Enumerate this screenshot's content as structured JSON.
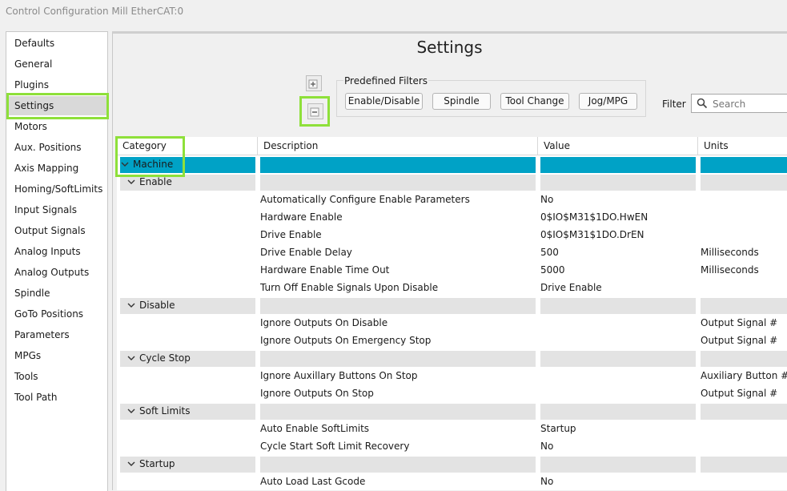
{
  "window": {
    "title": "Control Configuration Mill EtherCAT:0"
  },
  "sidebar": {
    "items": [
      {
        "label": "Defaults"
      },
      {
        "label": "General"
      },
      {
        "label": "Plugins"
      },
      {
        "label": "Settings",
        "selected": true
      },
      {
        "label": "Motors"
      },
      {
        "label": "Aux. Positions"
      },
      {
        "label": "Axis Mapping"
      },
      {
        "label": "Homing/SoftLimits"
      },
      {
        "label": "Input Signals"
      },
      {
        "label": "Output Signals"
      },
      {
        "label": "Analog Inputs"
      },
      {
        "label": "Analog Outputs"
      },
      {
        "label": "Spindle"
      },
      {
        "label": "GoTo Positions"
      },
      {
        "label": "Parameters"
      },
      {
        "label": "MPGs"
      },
      {
        "label": "Tools"
      },
      {
        "label": "Tool Path"
      }
    ]
  },
  "main": {
    "title": "Settings",
    "expand_icon": "expand-all-icon",
    "collapse_icon": "collapse-all-icon",
    "predefined_filters": {
      "legend": "Predefined Filters",
      "buttons": [
        "Enable/Disable",
        "Spindle",
        "Tool Change",
        "Jog/MPG"
      ]
    },
    "filter": {
      "label": "Filter",
      "placeholder": "Search",
      "value": ""
    }
  },
  "grid": {
    "columns": [
      "Category",
      "Description",
      "Value",
      "Units"
    ],
    "rows": [
      {
        "kind": "group",
        "level": 0,
        "category": "Machine",
        "selected": true
      },
      {
        "kind": "group",
        "level": 1,
        "category": "Enable"
      },
      {
        "kind": "item",
        "description": "Automatically Configure Enable Parameters",
        "value": "No",
        "units": ""
      },
      {
        "kind": "item",
        "description": "Hardware Enable",
        "value": "0$IO$M31$1DO.HwEN",
        "units": ""
      },
      {
        "kind": "item",
        "description": "Drive Enable",
        "value": "0$IO$M31$1DO.DrEN",
        "units": ""
      },
      {
        "kind": "item",
        "description": "Drive Enable Delay",
        "value": "500",
        "units": "Milliseconds"
      },
      {
        "kind": "item",
        "description": "Hardware Enable Time Out",
        "value": "5000",
        "units": "Milliseconds"
      },
      {
        "kind": "item",
        "description": "Turn Off Enable Signals Upon Disable",
        "value": "Drive Enable",
        "units": ""
      },
      {
        "kind": "group",
        "level": 1,
        "category": "Disable"
      },
      {
        "kind": "item",
        "description": "Ignore Outputs On Disable",
        "value": "",
        "units": "Output Signal #"
      },
      {
        "kind": "item",
        "description": "Ignore Outputs On Emergency Stop",
        "value": "",
        "units": "Output Signal #"
      },
      {
        "kind": "group",
        "level": 1,
        "category": "Cycle Stop"
      },
      {
        "kind": "item",
        "description": "Ignore Auxillary Buttons On Stop",
        "value": "",
        "units": "Auxiliary Button #"
      },
      {
        "kind": "item",
        "description": "Ignore Outputs On Stop",
        "value": "",
        "units": "Output Signal #"
      },
      {
        "kind": "group",
        "level": 1,
        "category": "Soft Limits"
      },
      {
        "kind": "item",
        "description": "Auto Enable SoftLimits",
        "value": "Startup",
        "units": ""
      },
      {
        "kind": "item",
        "description": "Cycle Start Soft Limit Recovery",
        "value": "No",
        "units": ""
      },
      {
        "kind": "group",
        "level": 1,
        "category": "Startup"
      },
      {
        "kind": "item",
        "description": "Auto Load Last Gcode",
        "value": "No",
        "units": ""
      }
    ]
  },
  "colors": {
    "selected_row": "#00a2c6",
    "group_fill": "#e3e3e3",
    "highlight": "#8ee03a",
    "sidebar_selected": "#d9d9d9"
  }
}
